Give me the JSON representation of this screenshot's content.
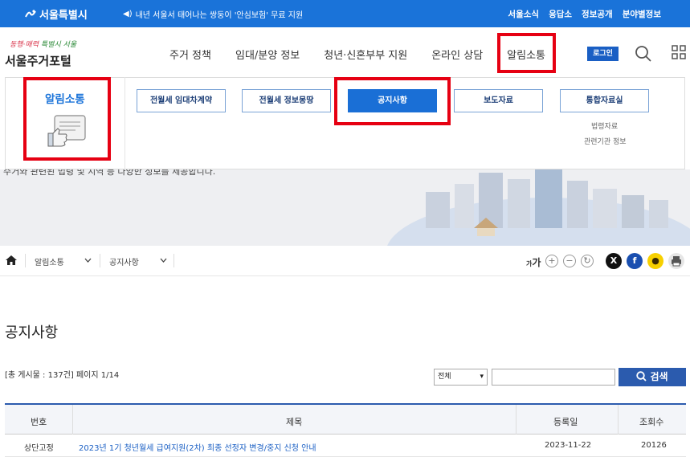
{
  "topbar": {
    "logo": "서울특별시",
    "notice": "내년 서울서 태어나는 쌍둥이 '안심보험' 무료 지원",
    "links": [
      "서울소식",
      "응답소",
      "정보공개",
      "분야별정보"
    ]
  },
  "header": {
    "slogan_a": "동행·매력",
    "slogan_b": "특별시 서울",
    "site_title": "서울주거포털",
    "gnb": [
      "주거 정책",
      "임대/분양 정보",
      "청년·신혼부부 지원",
      "온라인 상담",
      "알림소통"
    ],
    "login": "로그인"
  },
  "submenu": {
    "section_title": "알림소통",
    "buttons": [
      "전월세 임대차계약",
      "전월세 정보몽땅",
      "공지사항",
      "보도자료",
      "통합자료실"
    ],
    "active_index": 2,
    "sub_links": [
      "법령자료",
      "관련기관 정보"
    ]
  },
  "visual": {
    "desc": "주거와 관련된 법령 및 지역 등 다양한 정보를 제공합니다."
  },
  "breadcrumb": {
    "level1": "알림소통",
    "level2": "공지사항",
    "font_small": "가",
    "font_large": "가"
  },
  "share": {
    "x": "X",
    "facebook": "f",
    "kakao": "●"
  },
  "page": {
    "title": "공지사항",
    "count_info": "[총 게시물 : 137건] 페이지 1/14",
    "search_scope": "전체",
    "search_value": "",
    "search_button": "검색"
  },
  "table": {
    "headers": [
      "번호",
      "제목",
      "등록일",
      "조회수"
    ],
    "rows": [
      {
        "no": "상단고정",
        "title": "2023년 1기 청년월세 급여지원(2차) 최종 선정자 변경/중지 신청 안내",
        "date": "2023-11-22",
        "views": "20126"
      }
    ]
  },
  "colors": {
    "topbar": "#1a73d9",
    "accent": "#1a6fd6",
    "highlight": "#e60012",
    "search_button": "#2b5bae"
  }
}
